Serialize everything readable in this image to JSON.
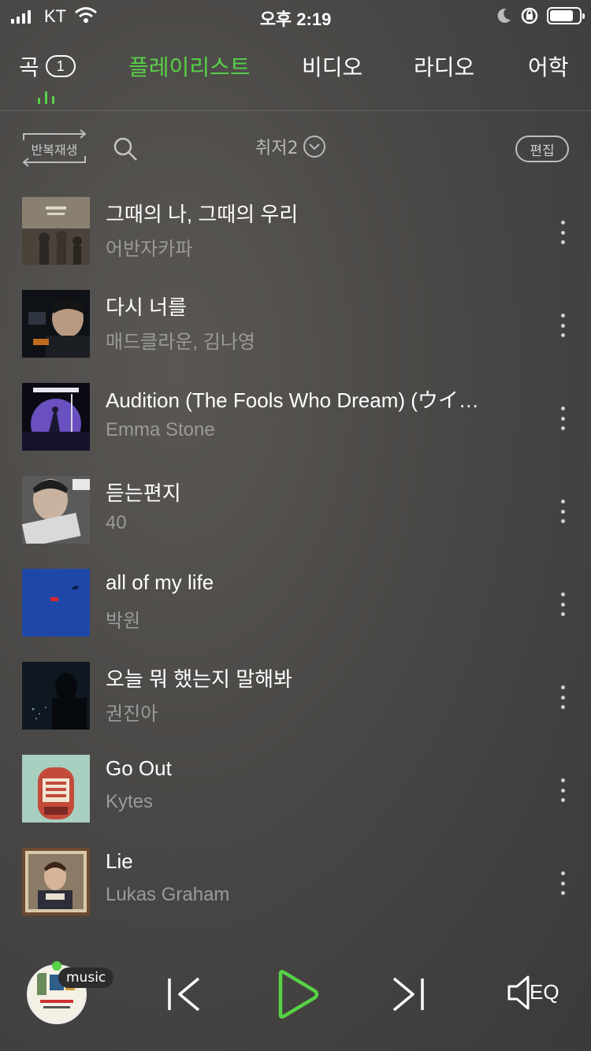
{
  "status_bar": {
    "carrier": "KT",
    "time": "오후 2:19"
  },
  "tabs": [
    {
      "label": "곡",
      "count": "1"
    },
    {
      "label": "플레이리스트",
      "active": true
    },
    {
      "label": "비디오"
    },
    {
      "label": "라디오"
    },
    {
      "label": "어학"
    }
  ],
  "toolbar": {
    "repeat_label": "반복재생",
    "sort_label": "취저2",
    "edit_label": "편집"
  },
  "tracks": [
    {
      "title": "그때의 나, 그때의 우리",
      "artist": "어반자카파"
    },
    {
      "title": "다시 너를",
      "artist": "매드클라운, 김나영"
    },
    {
      "title": "Audition (The Fools Who Dream) (ウイ…",
      "artist": "Emma Stone"
    },
    {
      "title": "듣는편지",
      "artist": "40"
    },
    {
      "title": "all of my life",
      "artist": "박원"
    },
    {
      "title": "오늘 뭐 했는지 말해봐",
      "artist": "권진아"
    },
    {
      "title": "Go Out",
      "artist": "Kytes"
    },
    {
      "title": "Lie",
      "artist": "Lukas Graham"
    }
  ],
  "player": {
    "badge": "music",
    "eq_label": "EQ"
  },
  "colors": {
    "accent": "#56d246"
  }
}
